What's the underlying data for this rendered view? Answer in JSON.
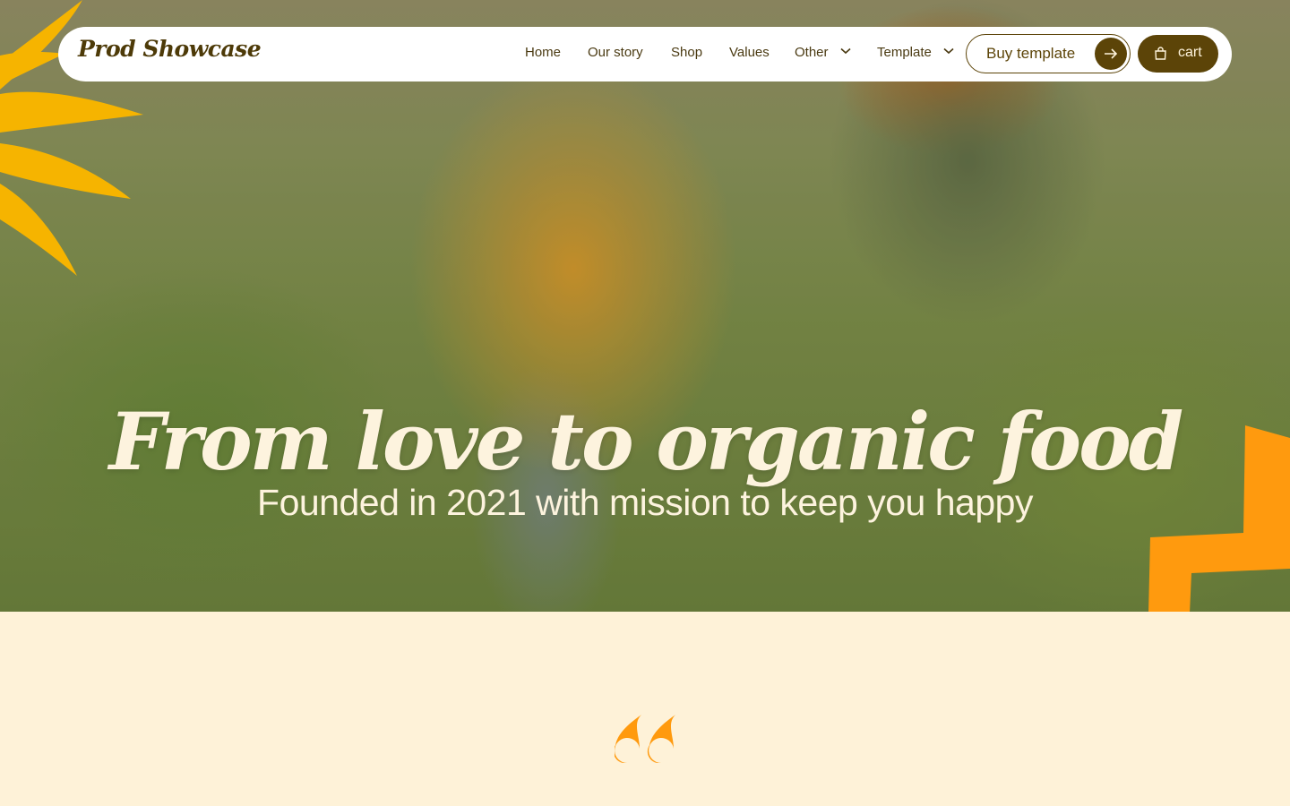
{
  "brand": {
    "logo_text": "Prod Showcase"
  },
  "nav": {
    "links": [
      "Home",
      "Our story",
      "Shop",
      "Values"
    ],
    "dropdowns": [
      "Other",
      "Template"
    ],
    "buy_label": "Buy template",
    "cart_label": "cart"
  },
  "hero": {
    "title": "From love to organic food",
    "subtitle": "Founded in 2021 with mission to keep you happy"
  },
  "colors": {
    "accent_yellow": "#f6b400",
    "accent_orange": "#ff9a0e",
    "brand_brown": "#5c4408",
    "cream": "#fef2d8"
  },
  "icons": [
    "chevron-down-icon",
    "arrow-right-icon",
    "shopping-bag-icon",
    "quote-icon"
  ]
}
